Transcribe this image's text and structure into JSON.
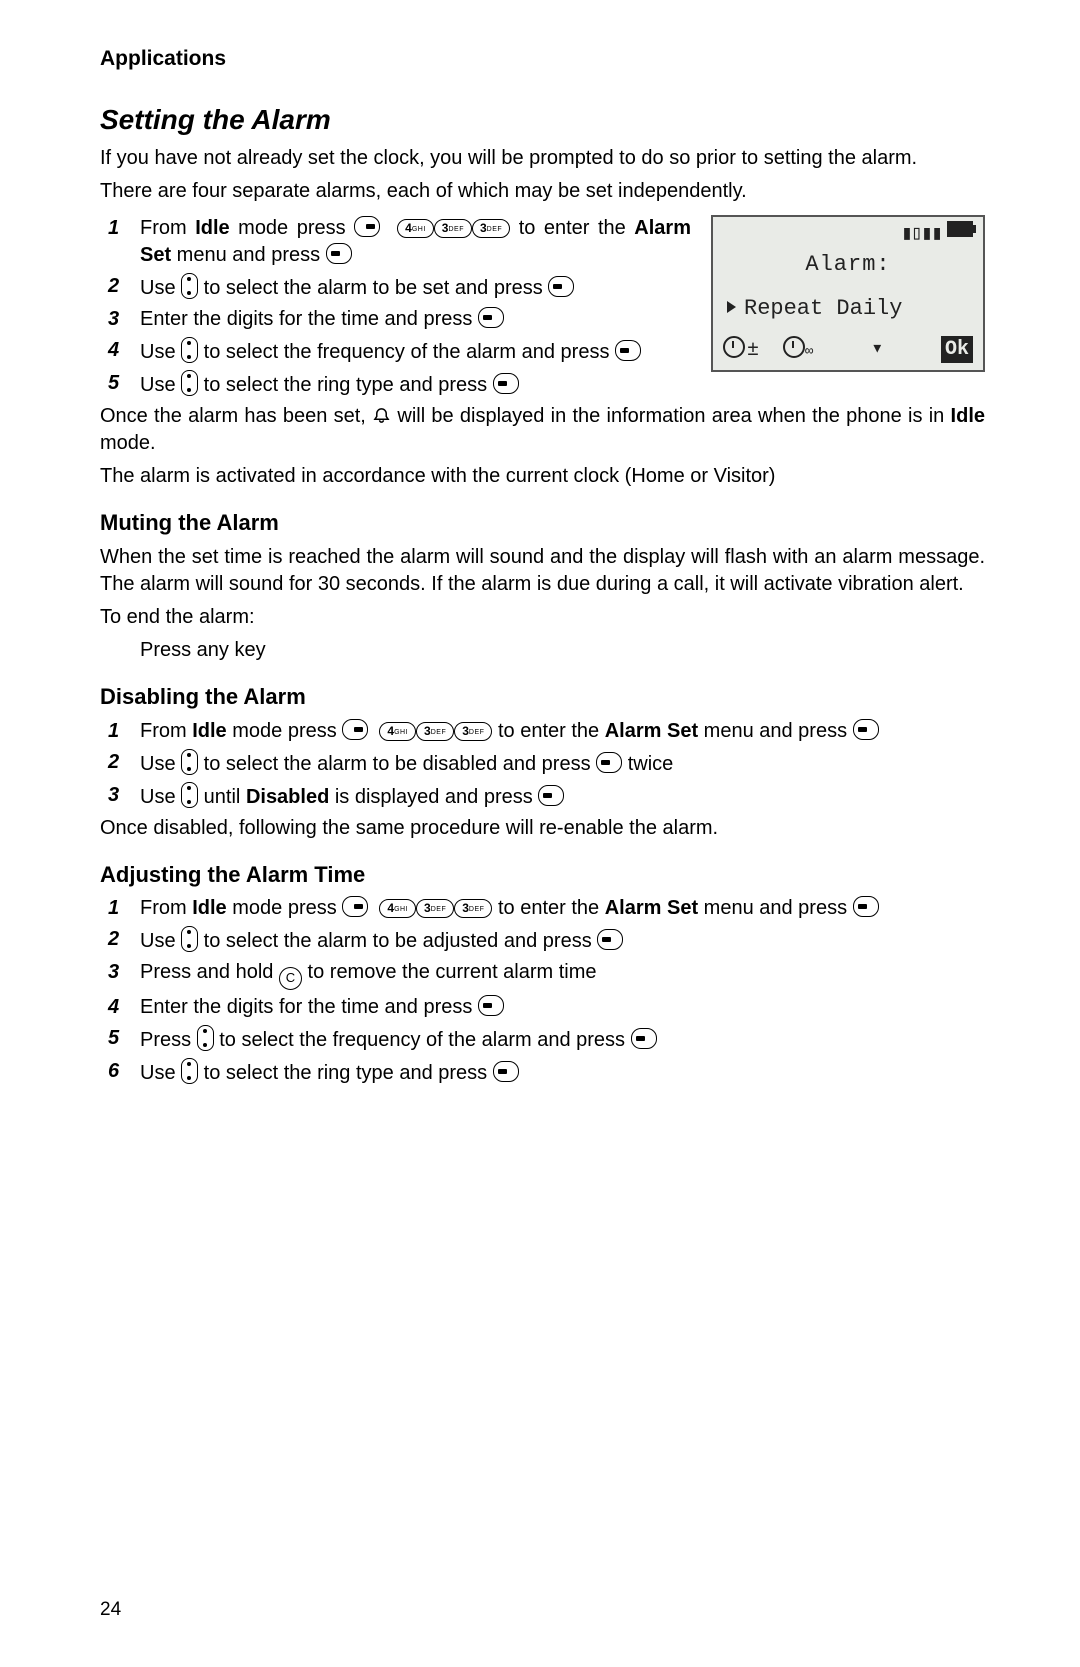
{
  "header": {
    "chapter": "Applications"
  },
  "section1": {
    "title": "Setting the Alarm",
    "intro1": "If you have not already set the clock, you will be prompted to do so prior to setting the alarm.",
    "intro2": "There are four separate alarms, each of which may be set independently.",
    "steps": {
      "s1a": "From ",
      "s1b": "Idle",
      "s1c": " mode press ",
      "s1d": " to enter the ",
      "s1e": "Alarm Set",
      "s1f": " menu and press ",
      "s2a": "Use ",
      "s2b": " to select the alarm to be set and press ",
      "s3a": "Enter the digits for the time and press ",
      "s4a": "Use ",
      "s4b": " to select the frequency of the alarm and press ",
      "s5a": "Use ",
      "s5b": " to select the ring type and press "
    },
    "after1a": "Once the alarm has been set, ",
    "after1b": " will be displayed in the information area when the phone is in ",
    "after1c": "Idle",
    "after1d": " mode.",
    "after2": "The alarm is activated in accordance with the current clock (Home or Visitor)"
  },
  "screen": {
    "title": "Alarm:",
    "selection": "Repeat Daily",
    "ok": "Ok"
  },
  "muting": {
    "title": "Muting the Alarm",
    "p1": "When the set time is reached the alarm will sound and the display will flash with an alarm message. The alarm will sound for 30 seconds. If the alarm is due during a call, it will activate vibration alert.",
    "p2": "To end the alarm:",
    "p3": "Press any key"
  },
  "disabling": {
    "title": "Disabling the Alarm",
    "s1a": "From ",
    "s1b": "Idle",
    "s1c": " mode press ",
    "s1d": " to enter the ",
    "s1e": "Alarm Set",
    "s1f": " menu and press ",
    "s2a": "Use ",
    "s2b": " to select the alarm to be disabled and press ",
    "s2c": " twice",
    "s3a": "Use ",
    "s3b": " until ",
    "s3c": "Disabled",
    "s3d": " is displayed and press ",
    "after": "Once disabled, following the same procedure will re-enable the alarm."
  },
  "adjusting": {
    "title": "Adjusting the Alarm Time",
    "s1a": "From ",
    "s1b": "Idle",
    "s1c": " mode press ",
    "s1d": " to enter the ",
    "s1e": "Alarm Set",
    "s1f": " menu and press ",
    "s2a": "Use ",
    "s2b": " to select the alarm to be adjusted and press ",
    "s3a": "Press and hold ",
    "s3b": " to remove the current alarm time",
    "s4a": "Enter the digits for the time and press ",
    "s5a": "Press ",
    "s5b": " to select the frequency of the alarm and press ",
    "s6a": "Use ",
    "s6b": " to select the ring type and press "
  },
  "keys": {
    "k4": "4",
    "k4s": "GHI",
    "k3": "3",
    "k3s": "DEF",
    "c": "C"
  },
  "page": "24"
}
